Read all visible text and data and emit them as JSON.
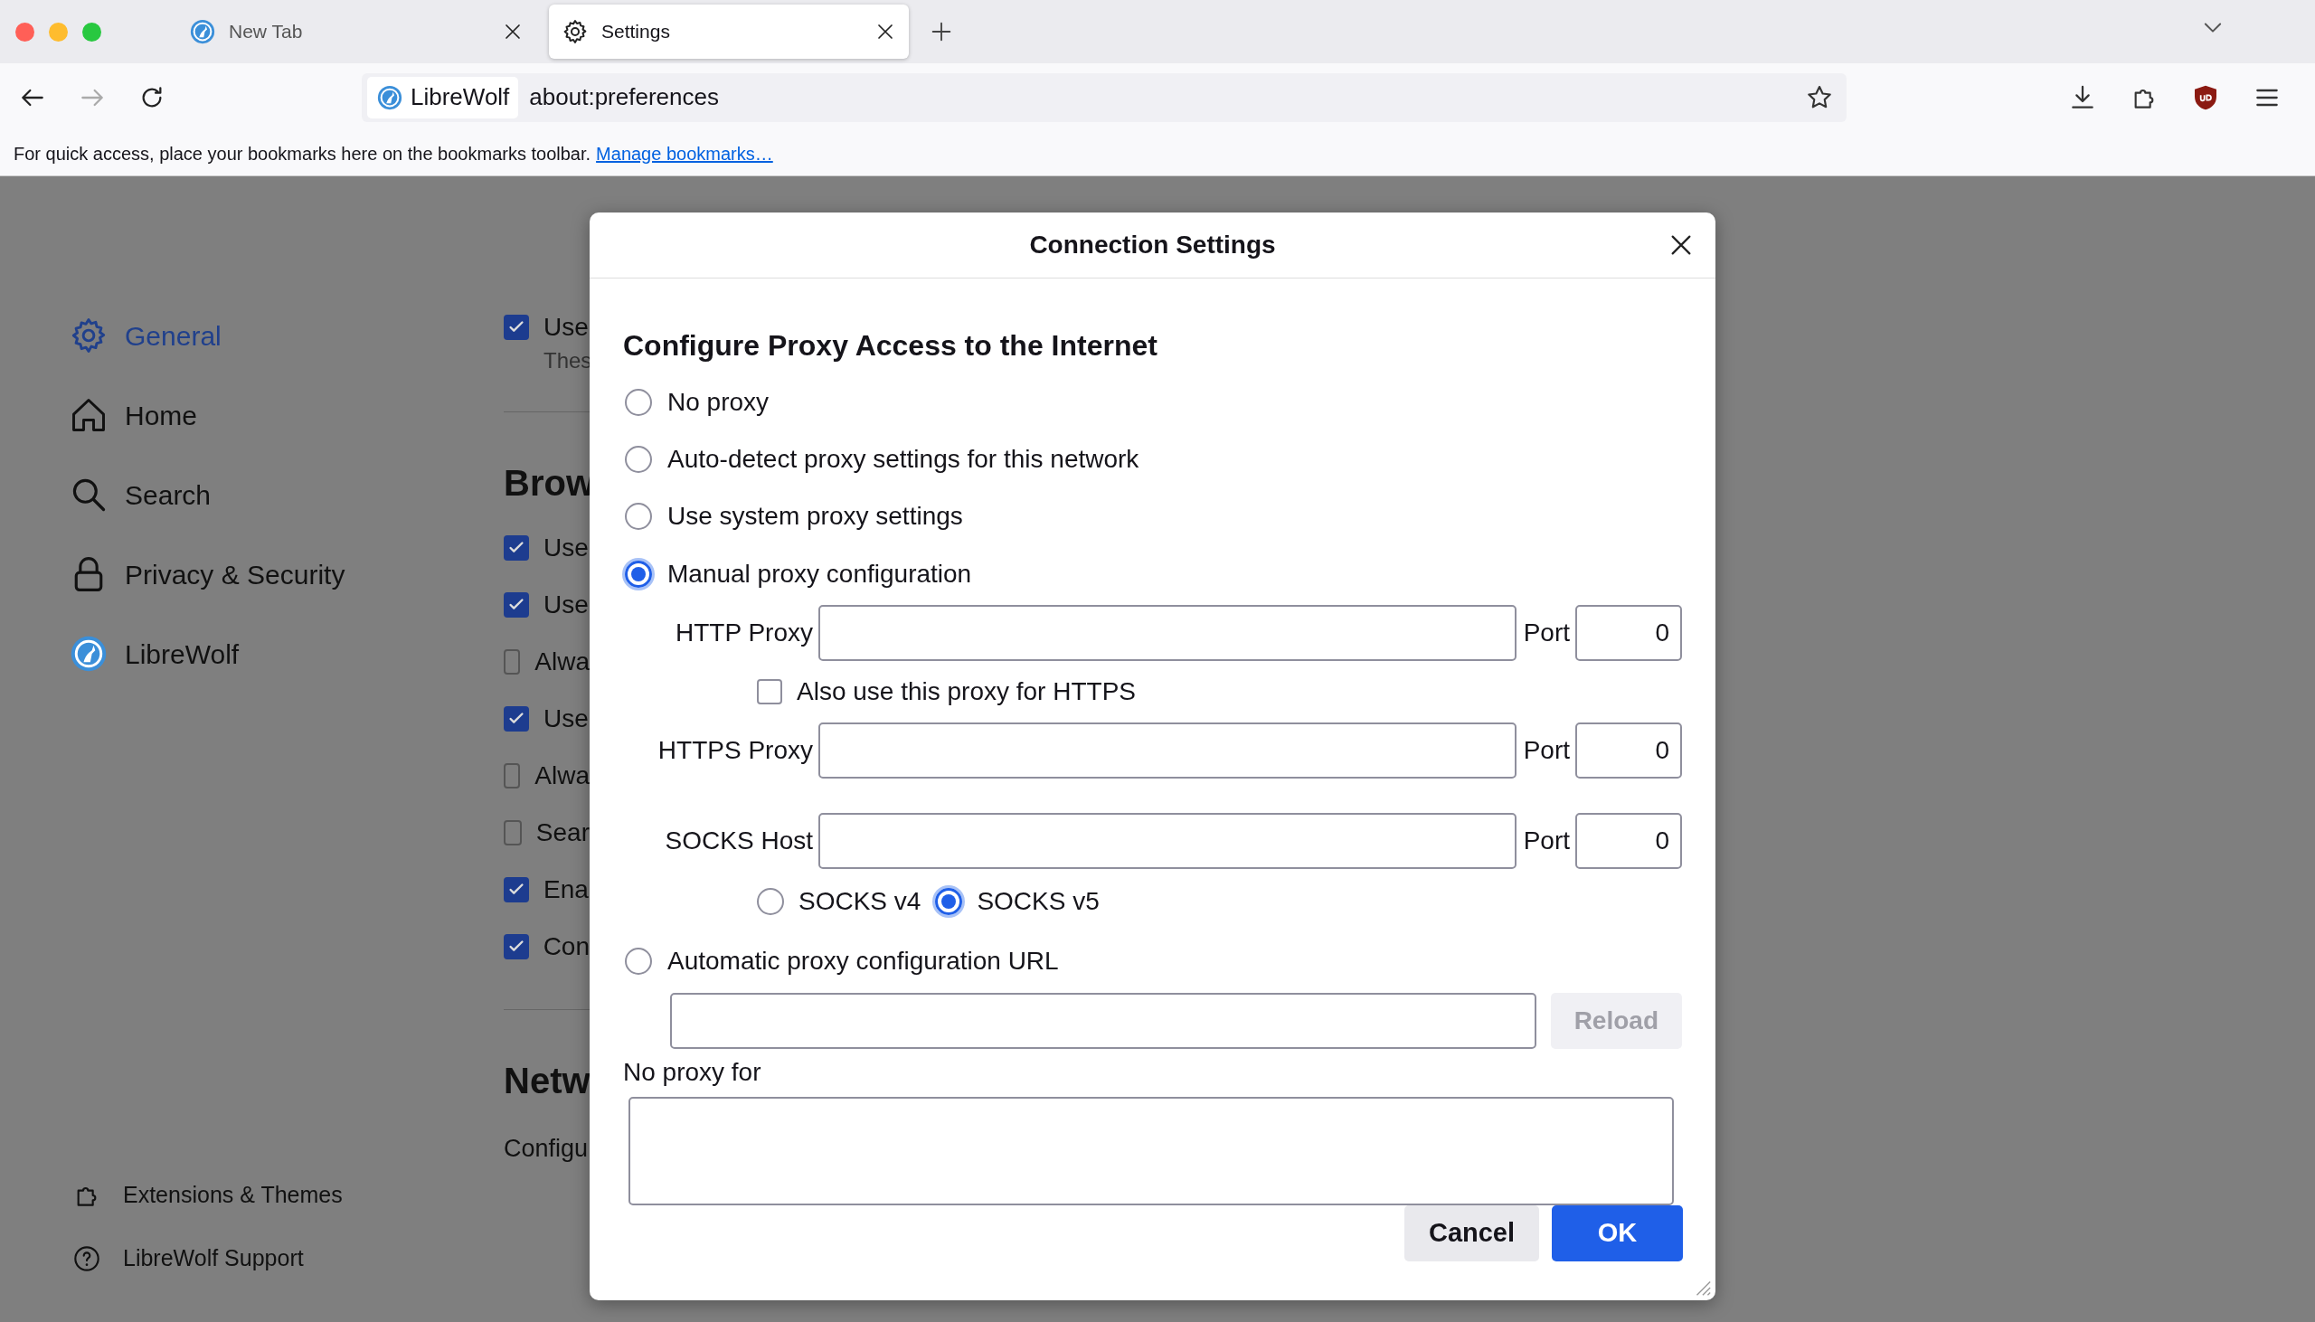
{
  "tabs": [
    {
      "label": "New Tab",
      "kind": "librewolf",
      "selected": false
    },
    {
      "label": "Settings",
      "kind": "gear",
      "selected": true
    }
  ],
  "toolbar": {
    "identity": "LibreWolf",
    "url": "about:preferences"
  },
  "bookmarks_bar": {
    "message": "For quick access, place your bookmarks here on the bookmarks toolbar.",
    "link": "Manage bookmarks…"
  },
  "sidebar": {
    "items": [
      {
        "label": "General",
        "kind": "gear",
        "selected": true
      },
      {
        "label": "Home",
        "kind": "home",
        "selected": false
      },
      {
        "label": "Search",
        "kind": "search",
        "selected": false
      },
      {
        "label": "Privacy & Security",
        "kind": "lock",
        "selected": false
      },
      {
        "label": "LibreWolf",
        "kind": "librewolf",
        "selected": false
      }
    ],
    "footer": [
      {
        "label": "Extensions & Themes",
        "kind": "puzzle"
      },
      {
        "label": "LibreWolf Support",
        "kind": "help"
      }
    ]
  },
  "background": [
    {
      "kind": "check",
      "label": "Use",
      "checked": true
    },
    {
      "kind": "note",
      "label": "Thes"
    },
    {
      "kind": "divider"
    },
    {
      "kind": "heading",
      "label": "Brow"
    },
    {
      "kind": "check",
      "label": "Use",
      "checked": true
    },
    {
      "kind": "check",
      "label": "Use",
      "checked": true
    },
    {
      "kind": "check",
      "label": "Alwa",
      "checked": false
    },
    {
      "kind": "check",
      "label": "Use",
      "checked": true
    },
    {
      "kind": "check",
      "label": "Alwa",
      "checked": false
    },
    {
      "kind": "check",
      "label": "Sear",
      "checked": false
    },
    {
      "kind": "check",
      "label": "Ena",
      "checked": true
    },
    {
      "kind": "check",
      "label": "Con",
      "checked": true
    },
    {
      "kind": "divider"
    },
    {
      "kind": "heading",
      "label": "Netw"
    },
    {
      "kind": "text",
      "label": "Configu"
    }
  ],
  "dialog": {
    "title": "Connection Settings",
    "heading": "Configure Proxy Access to the Internet",
    "modes": [
      {
        "kind": "plain",
        "label": "No proxy",
        "selected": false
      },
      {
        "kind": "plain",
        "label": "Auto-detect proxy settings for this network",
        "selected": false
      },
      {
        "kind": "plain",
        "label": "Use system proxy settings",
        "selected": false
      },
      {
        "kind": "manual",
        "label": "Manual proxy configuration",
        "selected": true,
        "rows": [
          {
            "kind": "field",
            "label": "HTTP Proxy",
            "port_label": "Port",
            "port": "0"
          },
          {
            "kind": "checkbox",
            "label": "Also use this proxy for HTTPS",
            "checked": false
          },
          {
            "kind": "field",
            "label": "HTTPS Proxy",
            "port_label": "Port",
            "port": "0"
          },
          {
            "kind": "field",
            "label": "SOCKS Host",
            "port_label": "Port",
            "port": "0"
          },
          {
            "kind": "radios",
            "options": [
              {
                "label": "SOCKS v4",
                "selected": false
              },
              {
                "label": "SOCKS v5",
                "selected": true
              }
            ]
          }
        ]
      },
      {
        "kind": "url",
        "label": "Automatic proxy configuration URL",
        "selected": false,
        "button": {
          "label": "Reload",
          "disabled": true
        }
      }
    ],
    "no_proxy": {
      "label": "No proxy for"
    },
    "buttons": [
      {
        "label": "Cancel",
        "kind": "secondary"
      },
      {
        "label": "OK",
        "kind": "primary"
      }
    ]
  }
}
